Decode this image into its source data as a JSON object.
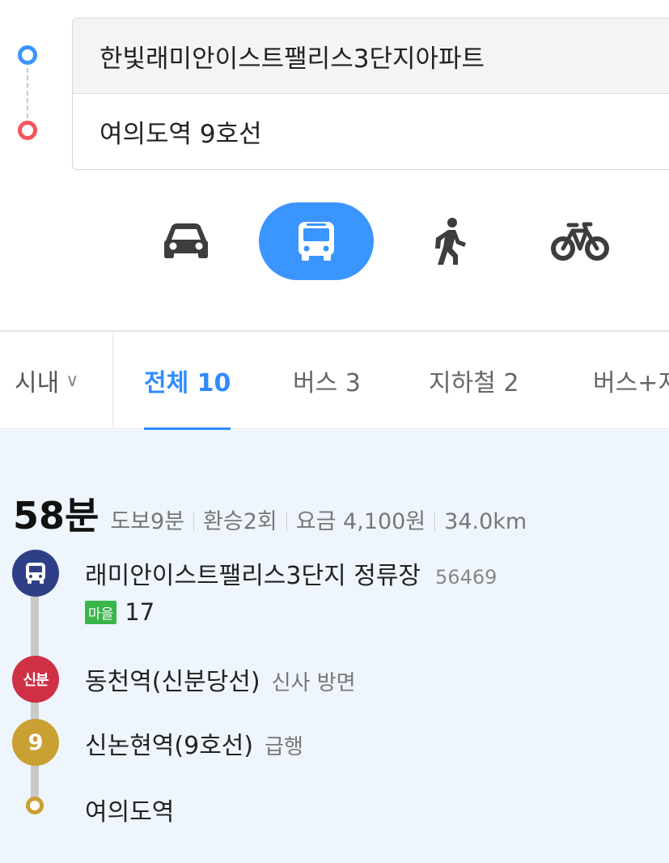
{
  "route": {
    "origin": "한빛래미안이스트팰리스3단지아파트",
    "destination": "여의도역 9호선"
  },
  "modes": [
    {
      "name": "car-icon",
      "selected": false
    },
    {
      "name": "bus-icon",
      "selected": true
    },
    {
      "name": "walk-icon",
      "selected": false
    },
    {
      "name": "bike-icon",
      "selected": false
    }
  ],
  "colors": {
    "accent": "#3a95ff",
    "origin_dot": "#3a95ff",
    "destination_dot": "#f2555a",
    "bus_node": "#2f3f87",
    "shinbundang_node": "#d03046",
    "line9_node": "#c9a032",
    "village_bus_badge": "#39b54a",
    "result_bg": "#eef5fd"
  },
  "filter": {
    "region": "시내",
    "tabs": [
      {
        "label": "전체 10",
        "active": true
      },
      {
        "label": "버스 3",
        "active": false
      },
      {
        "label": "지하철 2",
        "active": false
      },
      {
        "label": "버스+지",
        "active": false
      }
    ]
  },
  "result": {
    "total_time": "58분",
    "walk": "도보9분",
    "transfers": "환승2회",
    "fare": "요금 4,100원",
    "distance": "34.0km",
    "steps": [
      {
        "name": "래미안이스트팰리스3단지 정류장",
        "code": "56469",
        "badge": "마을",
        "bus_number": "17"
      },
      {
        "node_label": "신분",
        "name": "동천역(신분당선)",
        "sub": "신사 방면"
      },
      {
        "node_label": "9",
        "name": "신논현역(9호선)",
        "sub": "급행"
      },
      {
        "name": "여의도역"
      }
    ]
  }
}
